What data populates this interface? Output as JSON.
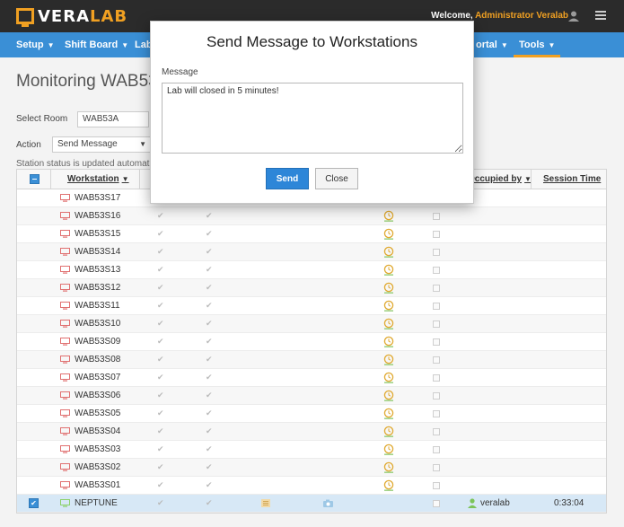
{
  "header": {
    "logo_main": "VERA",
    "logo_accent": "LAB",
    "welcome_prefix": "Welcome, ",
    "welcome_user": "Administrator Veralab"
  },
  "nav": [
    {
      "label": "Setup"
    },
    {
      "label": "Shift Board"
    },
    {
      "label": "Lab"
    },
    {
      "label": "ortal"
    },
    {
      "label": "Tools"
    }
  ],
  "page": {
    "title": "Monitoring WAB53",
    "room_label": "Select Room",
    "room_value": "WAB53A",
    "action_label": "Action",
    "action_value": "Send Message",
    "status_note": "Station status is updated automat"
  },
  "table": {
    "headers": {
      "workstation": "Workstation",
      "occupied_by": "Occupied by",
      "session_time": "Session Time"
    },
    "rows": [
      {
        "name": "WAB53S17"
      },
      {
        "name": "WAB53S16"
      },
      {
        "name": "WAB53S15"
      },
      {
        "name": "WAB53S14"
      },
      {
        "name": "WAB53S13"
      },
      {
        "name": "WAB53S12"
      },
      {
        "name": "WAB53S11"
      },
      {
        "name": "WAB53S10"
      },
      {
        "name": "WAB53S09"
      },
      {
        "name": "WAB53S08"
      },
      {
        "name": "WAB53S07"
      },
      {
        "name": "WAB53S06"
      },
      {
        "name": "WAB53S05"
      },
      {
        "name": "WAB53S04"
      },
      {
        "name": "WAB53S03"
      },
      {
        "name": "WAB53S02"
      },
      {
        "name": "WAB53S01"
      }
    ],
    "selected_row": {
      "name": "NEPTUNE",
      "occupied_by": "veralab",
      "session_time": "0:33:04"
    }
  },
  "modal": {
    "title": "Send Message to Workstations",
    "message_label": "Message",
    "message_value": "Lab will closed in 5 minutes!",
    "send_label": "Send",
    "close_label": "Close"
  },
  "colors": {
    "header_bg": "#2b2b2b",
    "nav_bg": "#3a8fd6",
    "accent": "#f0a022",
    "primary_button": "#2d86d8",
    "offline_station": "#e07070",
    "online_station": "#8cd16a"
  }
}
